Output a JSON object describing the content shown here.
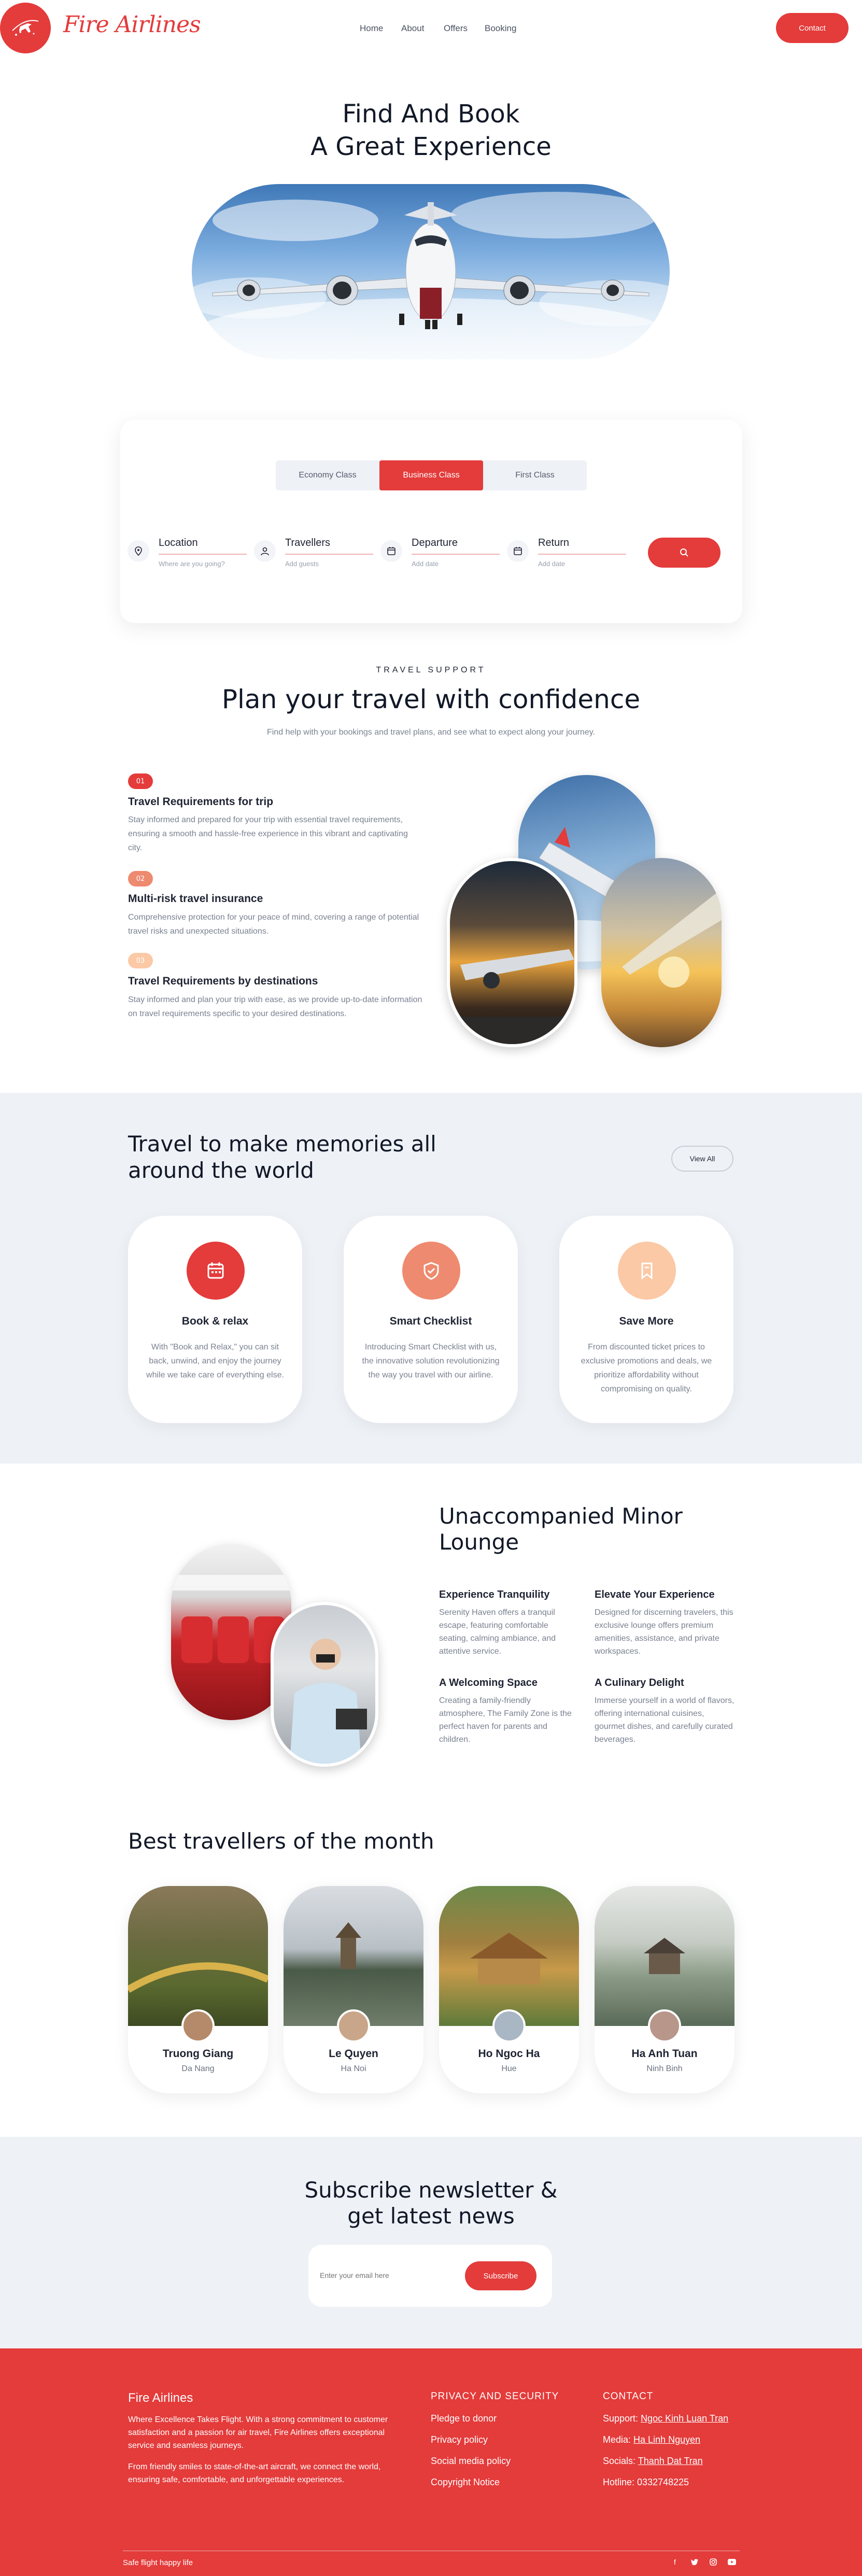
{
  "brand": {
    "name": "Fire Airlines",
    "logo_icon": "plane-logo-icon",
    "accent": "#e43b3b"
  },
  "nav": {
    "items": [
      "Home",
      "About",
      "Offers",
      "Booking"
    ],
    "contact": "Contact"
  },
  "hero": {
    "line1": "Find And Book",
    "line2": "A Great Experience"
  },
  "booking": {
    "tabs": [
      "Economy Class",
      "Business Class",
      "First Class"
    ],
    "active_tab": "Business Class",
    "fields": [
      {
        "label": "Location",
        "hint": "Where are you going?",
        "icon": "location-pin-icon"
      },
      {
        "label": "Travellers",
        "hint": "Add guests",
        "icon": "user-icon"
      },
      {
        "label": "Departure",
        "hint": "Add date",
        "icon": "calendar-icon"
      },
      {
        "label": "Return",
        "hint": "Add date",
        "icon": "calendar-icon"
      }
    ],
    "search_icon": "search-icon"
  },
  "support": {
    "eyebrow": "TRAVEL SUPPORT",
    "title": "Plan your travel with confidence",
    "subtitle": "Find help with your bookings and travel plans, and see what to expect along your journey.",
    "items": [
      {
        "num": "01",
        "title": "Travel Requirements for trip",
        "text": "Stay informed and prepared for your trip with essential travel requirements, ensuring a smooth and hassle-free experience in this vibrant and captivating city.",
        "color": "#e43b3b"
      },
      {
        "num": "02",
        "title": "Multi-risk travel insurance",
        "text": "Comprehensive protection for your peace of mind, covering a range of potential travel risks and unexpected situations.",
        "color": "#ee8a6f"
      },
      {
        "num": "03",
        "title": "Travel Requirements by destinations",
        "text": "Stay informed and plan your trip with ease, as we provide up-to-date information on travel requirements specific to your desired destinations.",
        "color": "#fbc9a6"
      }
    ]
  },
  "memories": {
    "title_line1": "Travel to make memories all",
    "title_line2": "around the world",
    "view_all": "View All",
    "cards": [
      {
        "title": "Book & relax",
        "text": "With \"Book and Relax,\" you can sit back, unwind, and enjoy the journey while we take care of everything else.",
        "icon": "calendar-icon",
        "color": "#e43b3b"
      },
      {
        "title": "Smart Checklist",
        "text": "Introducing Smart Checklist with us, the innovative solution revolutionizing the way you travel with our airline.",
        "icon": "shield-check-icon",
        "color": "#ee8a6f"
      },
      {
        "title": "Save More",
        "text": "From discounted ticket prices to exclusive promotions and deals, we prioritize affordability without compromising on quality.",
        "icon": "bookmark-icon",
        "color": "#fbc9a6"
      }
    ]
  },
  "lounge": {
    "title_line1": "Unaccompanied Minor",
    "title_line2": "Lounge",
    "features": [
      {
        "title": "Experience Tranquility",
        "text": "Serenity Haven offers a tranquil escape, featuring comfortable seating, calming ambiance, and attentive service."
      },
      {
        "title": "Elevate Your Experience",
        "text": "Designed for discerning travelers, this exclusive lounge offers premium amenities, assistance, and private workspaces."
      },
      {
        "title": "A Welcoming Space",
        "text": "Creating a family-friendly atmosphere, The Family Zone is the perfect haven for parents and children."
      },
      {
        "title": "A Culinary Delight",
        "text": "Immerse yourself in a world of flavors, offering international cuisines, gourmet dishes, and carefully curated beverages."
      }
    ]
  },
  "travellers": {
    "title": "Best travellers of the month",
    "people": [
      {
        "name": "Truong Giang",
        "city": "Da Nang"
      },
      {
        "name": "Le Quyen",
        "city": "Ha Noi"
      },
      {
        "name": "Ho Ngoc Ha",
        "city": "Hue"
      },
      {
        "name": "Ha Anh Tuan",
        "city": "Ninh Binh"
      }
    ]
  },
  "newsletter": {
    "title_line1": "Subscribe newsletter &",
    "title_line2": "get latest news",
    "placeholder": "Enter your email here",
    "button": "Subscribe"
  },
  "footer": {
    "brand": "Fire Airlines",
    "para1": "Where Excellence Takes Flight. With a strong commitment to customer satisfaction and a passion for air travel, Fire Airlines offers exceptional service and seamless journeys.",
    "para2": "From friendly smiles to state-of-the-art aircraft, we connect the world, ensuring safe, comfortable, and unforgettable experiences.",
    "privacy_title": "PRIVACY AND SECURITY",
    "privacy_links": [
      "Pledge to donor",
      "Privacy policy",
      "Social media policy",
      "Copyright Notice"
    ],
    "contact_title": "CONTACT",
    "contacts": [
      {
        "label": "Support:",
        "value": "Ngoc Kinh Luan Tran"
      },
      {
        "label": "Media:",
        "value": "Ha Linh Nguyen"
      },
      {
        "label": "Socials:",
        "value": "Thanh Dat Tran"
      },
      {
        "label": "Hotline:",
        "value": "0332748225"
      }
    ],
    "tagline": "Safe flight happy life",
    "socials": [
      "facebook-icon",
      "twitter-icon",
      "instagram-icon",
      "youtube-icon"
    ],
    "bg": "#e43b3b"
  }
}
